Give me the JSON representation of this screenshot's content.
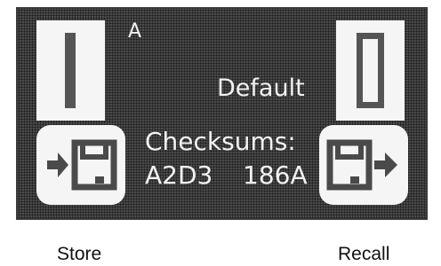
{
  "screen": {
    "slot_letter": "A",
    "default_label": "Default",
    "checksums_label": "Checksums:",
    "checksum_left": "A2D3",
    "checksum_right": "186A",
    "slot_number": "1",
    "default_slot_number": "0"
  },
  "buttons": {
    "store_label": "Store",
    "recall_label": "Recall",
    "store_icon": "save-to-disk-icon",
    "recall_icon": "load-from-disk-icon"
  }
}
